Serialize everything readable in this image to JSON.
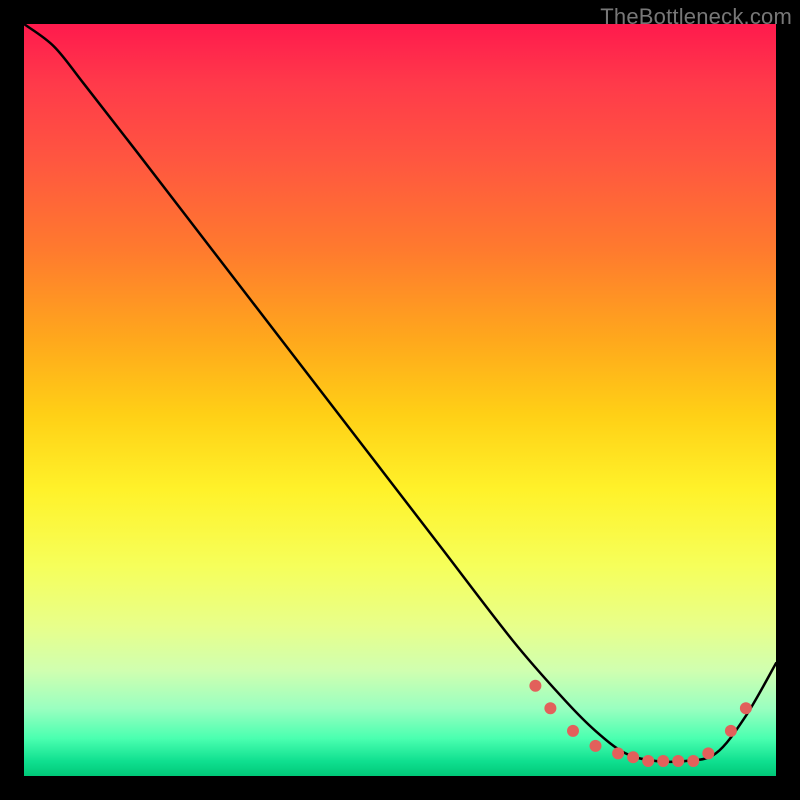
{
  "watermark": "TheBottleneck.com",
  "chart_data": {
    "type": "line",
    "title": "",
    "xlabel": "",
    "ylabel": "",
    "xlim": [
      0,
      100
    ],
    "ylim": [
      0,
      100
    ],
    "grid": false,
    "legend": false,
    "background_gradient": {
      "orientation": "vertical",
      "stops": [
        {
          "pos": 0.0,
          "color": "#ff1a4d"
        },
        {
          "pos": 0.3,
          "color": "#ff7a2e"
        },
        {
          "pos": 0.6,
          "color": "#fff22a"
        },
        {
          "pos": 0.85,
          "color": "#d0ffb0"
        },
        {
          "pos": 1.0,
          "color": "#00c878"
        }
      ]
    },
    "series": [
      {
        "name": "bottleneck-curve",
        "color": "#000000",
        "x": [
          0,
          4,
          8,
          15,
          25,
          35,
          45,
          55,
          65,
          72,
          76,
          80,
          84,
          88,
          92,
          96,
          100
        ],
        "y": [
          100,
          97,
          92,
          83,
          70,
          57,
          44,
          31,
          18,
          10,
          6,
          3,
          2,
          2,
          3,
          8,
          15
        ]
      }
    ],
    "markers": {
      "name": "highlight-dots",
      "color": "#e2605b",
      "x": [
        68,
        70,
        73,
        76,
        79,
        81,
        83,
        85,
        87,
        89,
        91,
        94,
        96
      ],
      "y": [
        12,
        9,
        6,
        4,
        3,
        2.5,
        2,
        2,
        2,
        2,
        3,
        6,
        9
      ]
    }
  }
}
